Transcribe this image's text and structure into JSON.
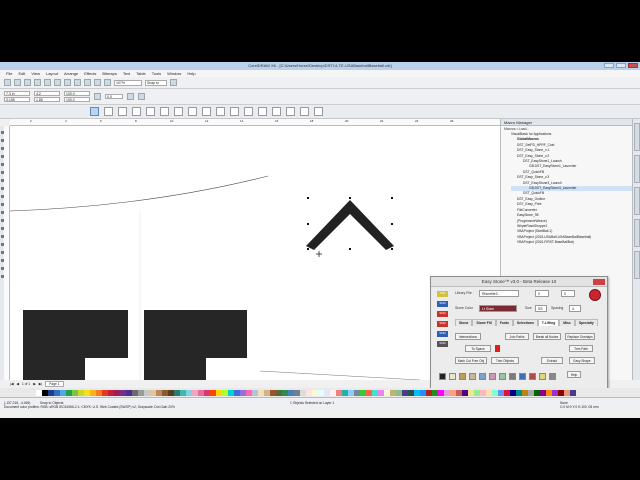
{
  "window": {
    "title": "CorelDRAW X6 - [C:\\Users\\Horse\\Desktop\\DST14-TE-USABaseballBaseball.cdr]"
  },
  "menu": [
    "File",
    "Edit",
    "View",
    "Layout",
    "Arrange",
    "Effects",
    "Bitmaps",
    "Text",
    "Table",
    "Tools",
    "Window",
    "Help"
  ],
  "toolbar": {
    "zoom": "107%",
    "snap": "Snap to"
  },
  "props": {
    "x": "7.3 in",
    "y": "0.155",
    "w": "4.2",
    "h": "1.85",
    "sx": "100.0",
    "sy": "100.0",
    "angle": "0.0"
  },
  "ruler_marks": [
    "2",
    "4",
    "6",
    "8",
    "10",
    "12",
    "14",
    "16",
    "18",
    "20",
    "22",
    "24",
    "26"
  ],
  "docker": {
    "title": "Macro Manager",
    "subtitle": "Macros • Load...",
    "tree": [
      {
        "label": "VisualBasic for Applications",
        "level": 1
      },
      {
        "label": "GlobalMacros",
        "level": 2
      },
      {
        "label": "DST_SetPD_HPRF_Cust",
        "level": 2
      },
      {
        "label": "DST_Easy_Stone_v.1",
        "level": 2
      },
      {
        "label": "DST_Easy_Stone_v.2",
        "level": 2
      },
      {
        "label": "DST_EasyStone1_Launch",
        "level": 3
      },
      {
        "label": "GB.DST_EasyStone1_Launcher",
        "level": 4
      },
      {
        "label": "DST_QuickFill",
        "level": 3
      },
      {
        "label": "DST_Easy_Stone_v.3",
        "level": 2
      },
      {
        "label": "DST_EasyStone3_Launch",
        "level": 3
      },
      {
        "label": "GB.DST_EasyStone3_Launcher",
        "level": 4
      },
      {
        "label": "DST_QuickFill",
        "level": 3
      },
      {
        "label": "DST_Easy_Outline",
        "level": 2
      },
      {
        "label": "DST_Easy_Print",
        "level": 2
      },
      {
        "label": "FileConverter",
        "level": 2
      },
      {
        "label": "EasyStone_98",
        "level": 2
      },
      {
        "label": "(ProgressiveWeave)",
        "level": 2
      },
      {
        "label": "WhyteRoseShoppe1",
        "level": 2
      },
      {
        "label": "VBAProject (StartBall-1)",
        "level": 2
      },
      {
        "label": "VBAProject (2015-USABall-USABaseBallBaseball)",
        "level": 2
      },
      {
        "label": "VBAProject (2015-FIRST-BaseBallBat)",
        "level": 2
      }
    ]
  },
  "easystone": {
    "title": "Easy Stone™ v3.0 - Beta Release 10",
    "library_label": "Library File",
    "library_value": "Rhinefile3",
    "stone_color_label": "Stone Color",
    "stone_color_value": "Lt Siam",
    "size_label": "Size",
    "size_value": "SS",
    "spacing_label": "Spacing",
    "spacing_value": "4",
    "field_a": "0",
    "field_b": "0",
    "tabs": [
      "Stone",
      "Stone Fill",
      "Fonts",
      "Selections",
      "T-Lifting",
      "Misc",
      "Specialty"
    ],
    "active_tab": "T-Lifting",
    "chips": [
      {
        "label": "SS8",
        "color": "#d2c23a"
      },
      {
        "label": "SS10",
        "color": "#2f5fb0"
      },
      {
        "label": "SS16",
        "color": "#c8332d"
      },
      {
        "label": "SS20",
        "color": "#c8332d"
      },
      {
        "label": "SS30",
        "color": "#2f5fb0"
      },
      {
        "label": "SS40",
        "color": "#555555"
      }
    ],
    "buttons": {
      "intersections": "Intersections",
      "join_paths": "Join Paths",
      "break_nodes": "Break all Nodes",
      "replace_overlaps": "Replace Overlaps",
      "to_space": "To Space",
      "trim_path": "Trim Path",
      "mark_cut": "Mark Cut Free Obj",
      "trim_objects": "Trim Objects",
      "extract": "Extract",
      "easy_shape": "Easy Shape",
      "help": "Help"
    },
    "swatches": [
      "#222222",
      "#e8e4d0",
      "#b8a05a",
      "#c7b79b",
      "#7aa3c8",
      "#c89bb1",
      "#9cc2a4",
      "#7b7b7b",
      "#3c6fb5",
      "#b34a4a",
      "#e0d77a",
      "#888888"
    ]
  },
  "status": {
    "selection": "1 Objects Selected on Layer 1",
    "coords": "(-137.215, -4.469)",
    "snap": "Snap to Objects",
    "doc_info": "Document color profiles: RGB: sRGB IEC61966-2.1; CMYK: U.S. Web Coated (SWOP) v2; Grayscale: Dot Gain 20%",
    "fill": "None",
    "outline": "C:0 M:0 Y:0 K:100  .05 mm"
  },
  "pages": {
    "current": "1 of 1",
    "tab": "Page 1"
  },
  "palette": [
    "#ffffff",
    "#000000",
    "#1d3f8a",
    "#2f6fc1",
    "#51a8e6",
    "#1fa34d",
    "#7fc242",
    "#c6d92b",
    "#f4e11c",
    "#f9b218",
    "#f57f20",
    "#e7391f",
    "#c11f3a",
    "#a01c55",
    "#7a2c8b",
    "#4b2f8e",
    "#6a6a6a",
    "#9a9a9a",
    "#c8c8c8",
    "#e5c4a0",
    "#b88a5a",
    "#8a5b2c",
    "#5e3b1a",
    "#2b7a6f",
    "#3fb9b0",
    "#86d0e5",
    "#f0a4c4",
    "#e76d9b",
    "#d93a6e",
    "#ff4500",
    "#ffd700",
    "#adff2f",
    "#00ced1",
    "#4169e1",
    "#9370db",
    "#ff69b4",
    "#b0c4de",
    "#f5deb3",
    "#d2b48c",
    "#a0522d",
    "#556b2f",
    "#2e8b57",
    "#4682b4",
    "#708090",
    "#dcdcdc",
    "#ffe4e1",
    "#fafad2",
    "#e0ffff",
    "#e6e6fa",
    "#fff0f5",
    "#f08080",
    "#20b2aa",
    "#87cefa",
    "#778899",
    "#32cd32",
    "#ff6347",
    "#40e0d0",
    "#ee82ee",
    "#f5f5dc",
    "#bdb76b",
    "#8fbc8f",
    "#483d8b",
    "#2f4f4f",
    "#00bfff",
    "#1e90ff",
    "#b22222",
    "#228b22",
    "#ff00ff",
    "#dda0dd",
    "#ffa07a",
    "#cd5c5c",
    "#4b0082",
    "#f0e68c",
    "#90ee90",
    "#ffb6c1",
    "#ffdead",
    "#7fffd4",
    "#6495ed",
    "#dc143c",
    "#00008b",
    "#008b8b",
    "#b8860b",
    "#a9a9a9",
    "#006400",
    "#8b008b",
    "#ff8c00",
    "#9932cc",
    "#8b0000",
    "#e9967a",
    "#483d8b"
  ]
}
